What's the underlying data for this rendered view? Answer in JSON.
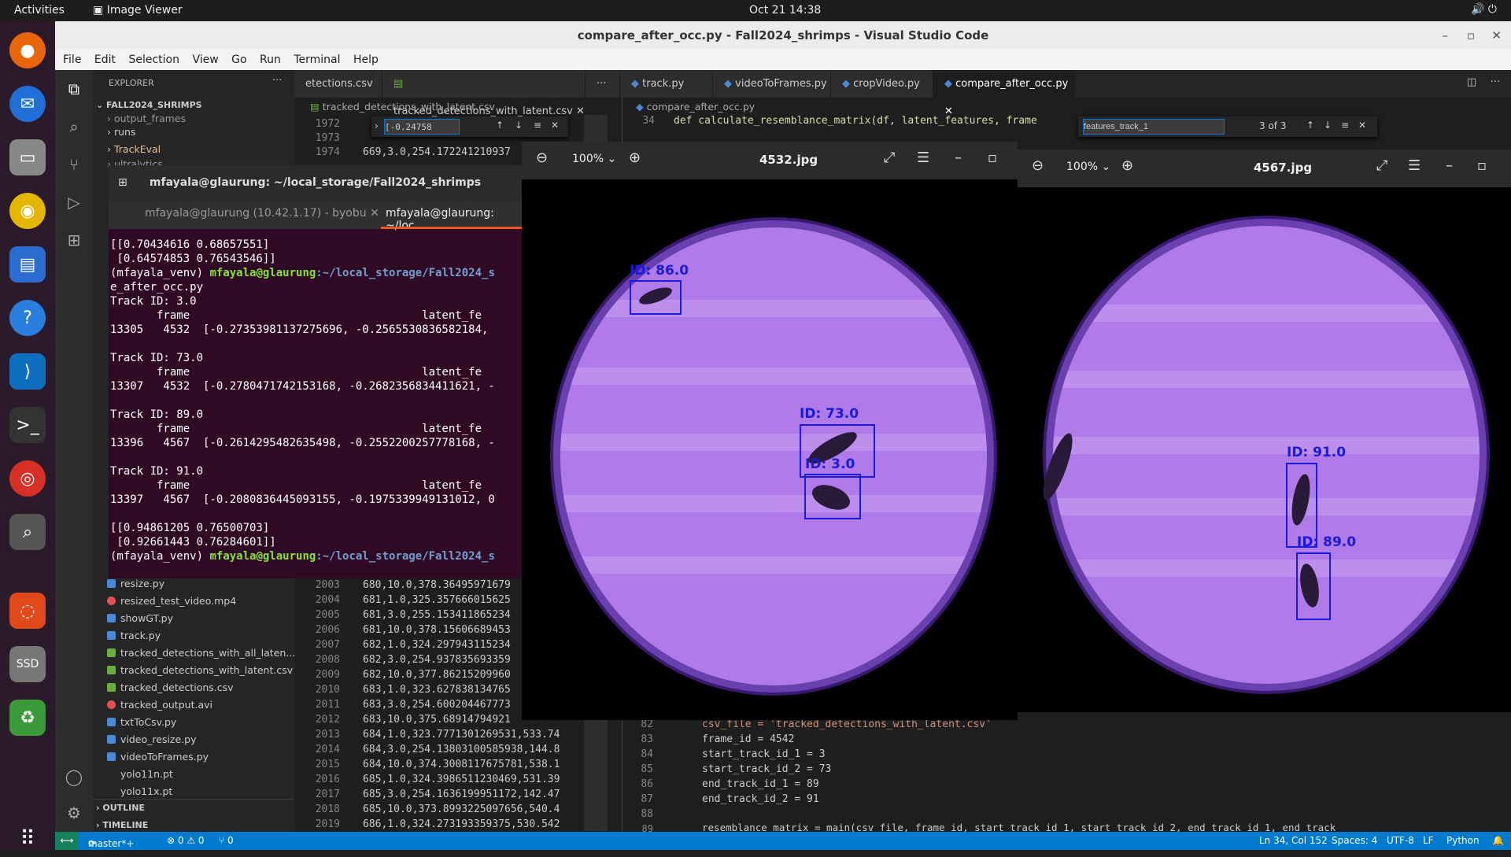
{
  "topbar": {
    "activities": "Activities",
    "app": "Image Viewer",
    "clock": "Oct 21  14:38"
  },
  "vscode": {
    "title": "compare_after_occ.py - Fall2024_shrimps - Visual Studio Code",
    "menu": [
      "File",
      "Edit",
      "Selection",
      "View",
      "Go",
      "Run",
      "Terminal",
      "Help"
    ],
    "explorer_label": "EXPLORER",
    "root": "FALL2024_SHRIMPS",
    "tree_top": [
      "output_frames",
      "runs",
      "TrackEval",
      "ultralytics"
    ],
    "files": [
      "resize.py",
      "resized_test_video.mp4",
      "showGT.py",
      "track.py",
      "tracked_detections_with_all_laten...",
      "tracked_detections_with_latent.csv",
      "tracked_detections.csv",
      "tracked_output.avi",
      "txtToCsv.py",
      "video_resize.py",
      "videoToFrames.py",
      "yolo11n.pt",
      "yolo11x.pt"
    ],
    "outline": "OUTLINE",
    "timeline": "TIMELINE",
    "tabs_left": [
      "etections.csv",
      "tracked_detections_with_latent.csv"
    ],
    "tabs_right": [
      "track.py",
      "videoToFrames.py",
      "cropVideo.py",
      "compare_after_occ.py"
    ],
    "breadcrumb_left": "tracked_detections_with_latent.csv",
    "breadcrumb_right": "compare_after_occ.py",
    "find_left": "[-0.24758",
    "find_right": "features_track_1",
    "find_count": "3 of 3",
    "csv_top": [
      {
        "n": "1972",
        "t": ""
      },
      {
        "n": "1973",
        "t": ""
      },
      {
        "n": "1974",
        "t": "669,3.0,254.172241210937"
      }
    ],
    "csv_lines": [
      {
        "n": "2003",
        "t": "680,10.0,378.36495971679"
      },
      {
        "n": "2004",
        "t": "681,1.0,325.357666015625"
      },
      {
        "n": "2005",
        "t": "681,3.0,255.153411865234"
      },
      {
        "n": "2006",
        "t": "681,10.0,378.15606689453"
      },
      {
        "n": "2007",
        "t": "682,1.0,324.297943115234"
      },
      {
        "n": "2008",
        "t": "682,3.0,254.937835693359"
      },
      {
        "n": "2009",
        "t": "682,10.0,377.86215209960"
      },
      {
        "n": "2010",
        "t": "683,1.0,323.627838134765"
      },
      {
        "n": "2011",
        "t": "683,3.0,254.600204467773"
      },
      {
        "n": "2012",
        "t": "683,10.0,375.68914794921"
      },
      {
        "n": "2013",
        "t": "684,1.0,323.7771301269531,533.74"
      },
      {
        "n": "2014",
        "t": "684,3.0,254.13803100585938,144.8"
      },
      {
        "n": "2015",
        "t": "684,10.0,374.3008117675781,538.1"
      },
      {
        "n": "2016",
        "t": "685,1.0,324.3986511230469,531.39"
      },
      {
        "n": "2017",
        "t": "685,3.0,254.1636199951172,142.47"
      },
      {
        "n": "2018",
        "t": "685,10.0,373.8993225097656,540.4"
      },
      {
        "n": "2019",
        "t": "686,1.0,324.273193359375,530.542"
      }
    ],
    "py_top": {
      "n": "34",
      "t": "def calculate_resemblance_matrix(df, latent_features, frame"
    },
    "py_lines": [
      {
        "n": "82",
        "t": "csv_file = 'tracked_detections_with_latent.csv'"
      },
      {
        "n": "83",
        "t": "frame_id = 4542"
      },
      {
        "n": "84",
        "t": "start_track_id_1 = 3"
      },
      {
        "n": "85",
        "t": "start_track_id_2 = 73"
      },
      {
        "n": "86",
        "t": "end_track_id_1 = 89"
      },
      {
        "n": "87",
        "t": "end_track_id_2 = 91"
      },
      {
        "n": "88",
        "t": ""
      },
      {
        "n": "89",
        "t": "resemblance_matrix = main(csv_file, frame_id, start_track_id_1, start_track_id_2, end_track_id_1, end_track"
      }
    ],
    "status": {
      "branch": "master*+",
      "problems": "⊗ 0 ⚠ 0",
      "ports": "⑂ 0",
      "cursor": "Ln 34, Col 152",
      "spaces": "Spaces: 4",
      "encoding": "UTF-8",
      "eol": "LF",
      "lang": "Python"
    }
  },
  "terminal": {
    "title": "mfayala@glaurung: ~/local_storage/Fall2024_shrimps",
    "tab1": "mfayala@glaurung (10.42.1.17) - byobu",
    "tab2": "mfayala@glaurung: ~/loc",
    "lines": [
      {
        "t": "[[0.70434616 0.68657551]",
        "c": ""
      },
      {
        "t": " [0.64574853 0.76543546]]",
        "c": ""
      },
      {
        "t": "(mfayala_venv) ",
        "c": "p",
        "u": "mfayala@glaurung",
        "d": ":~/local_storage/Fall2024_s"
      },
      {
        "t": "e_after_occ.py",
        "c": ""
      },
      {
        "t": "Track ID: 3.0",
        "c": ""
      },
      {
        "t": "       frame                                   latent_fe",
        "c": ""
      },
      {
        "t": "13305   4532  [-0.27353981137275696, -0.2565530836582184, ",
        "c": ""
      },
      {
        "t": "",
        "c": ""
      },
      {
        "t": "Track ID: 73.0",
        "c": ""
      },
      {
        "t": "       frame                                   latent_fe",
        "c": ""
      },
      {
        "t": "13307   4532  [-0.2780471742153168, -0.2682356834411621, -",
        "c": ""
      },
      {
        "t": "",
        "c": ""
      },
      {
        "t": "Track ID: 89.0",
        "c": ""
      },
      {
        "t": "       frame                                   latent_fe",
        "c": ""
      },
      {
        "t": "13396   4567  [-0.2614295482635498, -0.2552200257778168, -",
        "c": ""
      },
      {
        "t": "",
        "c": ""
      },
      {
        "t": "Track ID: 91.0",
        "c": ""
      },
      {
        "t": "       frame                                   latent_fe",
        "c": ""
      },
      {
        "t": "13397   4567  [-0.2080836445093155, -0.1975339949131012, 0",
        "c": ""
      },
      {
        "t": "",
        "c": ""
      },
      {
        "t": "[[0.94861205 0.76500703]",
        "c": ""
      },
      {
        "t": " [0.92661443 0.76284601]]",
        "c": ""
      },
      {
        "t": "(mfayala_venv) ",
        "c": "p",
        "u": "mfayala@glaurung",
        "d": ":~/local_storage/Fall2024_s"
      }
    ]
  },
  "viewer1": {
    "zoom": "100%",
    "title": "4532.jpg",
    "ids": [
      "ID: 86.0",
      "ID: 73.0",
      "ID: 3.0"
    ]
  },
  "viewer2": {
    "zoom": "100%",
    "title": "4567.jpg",
    "ids": [
      "ID: 91.0",
      "ID: 89.0"
    ]
  }
}
